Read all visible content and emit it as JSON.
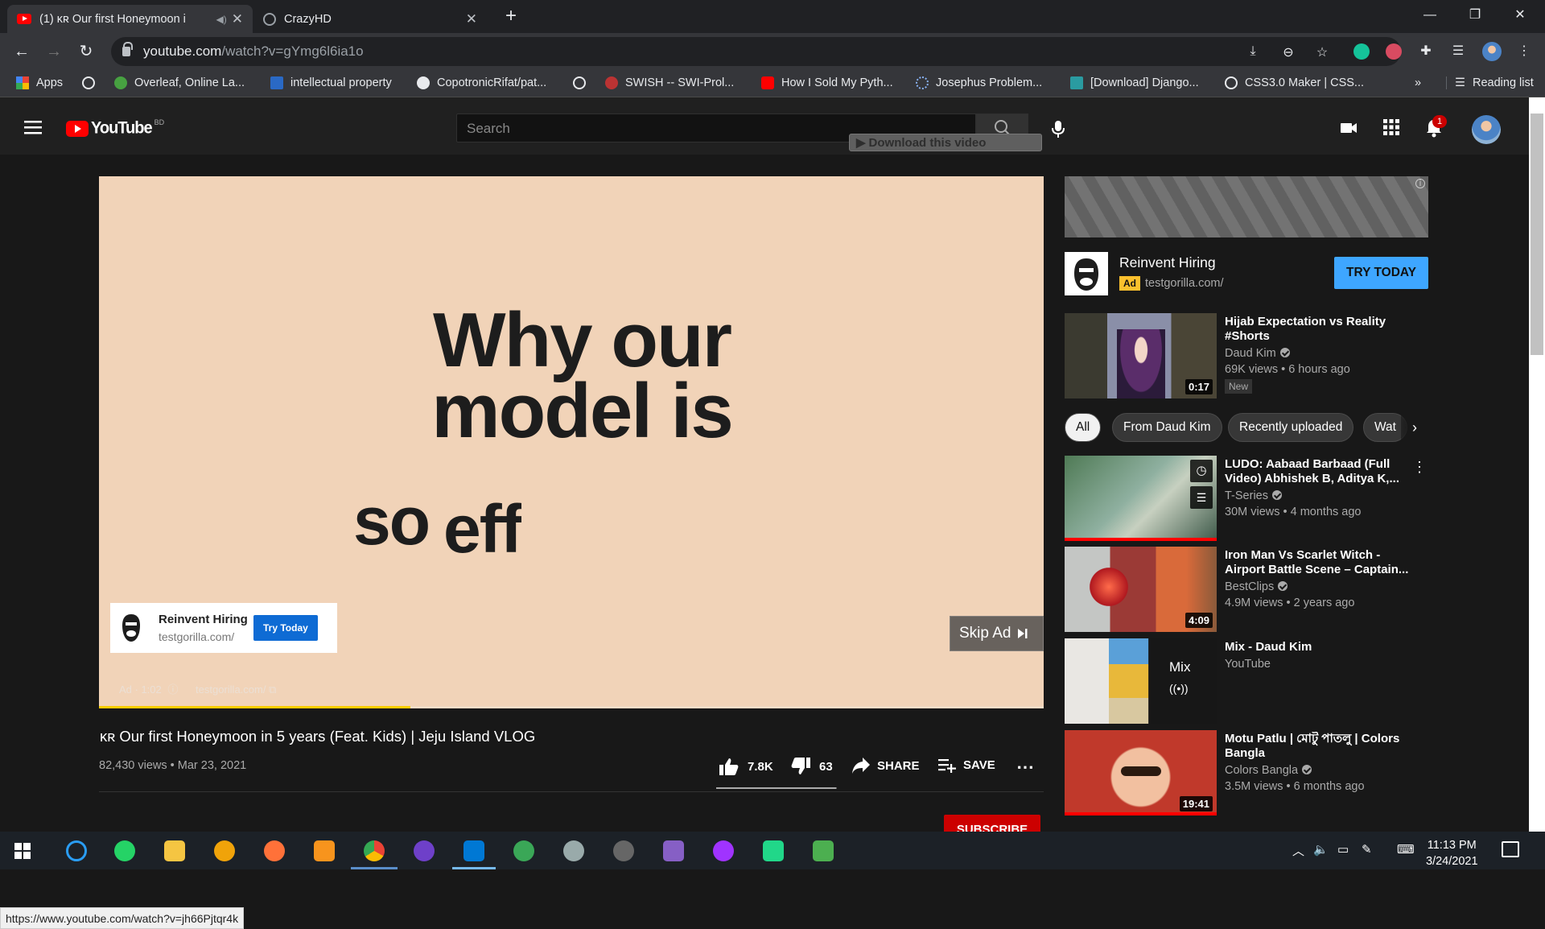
{
  "browser": {
    "tabs": [
      {
        "title": "(1) ĸʀ Our first Honeymoon i",
        "active": true
      },
      {
        "title": "CrazyHD",
        "active": false
      }
    ],
    "url_host": "youtube.com",
    "url_path": "/watch?v=gYmg6l6ia1o",
    "reading_list": "Reading list",
    "bookmarks": [
      "Apps",
      "Overleaf, Online La...",
      "intellectual property",
      "CopotronicRifat/pat...",
      "SWISH -- SWI-Prol...",
      "How I Sold My Pyth...",
      "Josephus Problem...",
      "[Download] Django...",
      "CSS3.0 Maker | CSS..."
    ],
    "overflow": "»"
  },
  "youtube": {
    "logo": "YouTube",
    "country": "BD",
    "search_placeholder": "Search",
    "download_label": "Download this video",
    "notif_count": "1",
    "video": {
      "slide_line1": "Why our",
      "slide_line2": "model is",
      "slide_line3_a": "so",
      "slide_line3_b": "eff",
      "ad_name": "Reinvent Hiring",
      "ad_domain": "testgorilla.com/",
      "ad_btn": "Try Today",
      "skip": "Skip Ad",
      "ad_time": "Ad · 1:02",
      "ad_link": "testgorilla.com/",
      "ad_progress": 0.33,
      "title": "ĸʀ Our first Honeymoon in 5 years (Feat. Kids) | Jeju Island VLOG",
      "meta": "82,430 views • Mar 23, 2021",
      "likes": "7.8K",
      "dislikes": "63",
      "like_ratio": 0.99,
      "share": "SHARE",
      "save": "SAVE",
      "subscribe": "SUBSCRIBE"
    },
    "side_ad": {
      "name": "Reinvent Hiring",
      "ad_badge": "Ad",
      "domain": "testgorilla.com/",
      "cta": "TRY TODAY"
    },
    "chips": [
      "All",
      "From Daud Kim",
      "Recently uploaded",
      "Wat"
    ],
    "recs": [
      {
        "title": "Hijab Expectation vs Reality #Shorts",
        "channel": "Daud Kim",
        "meta": "69K views • 6 hours ago",
        "badge": "New",
        "duration": "0:17"
      },
      {
        "title": "LUDO: Aabaad Barbaad (Full Video) Abhishek B, Aditya K,...",
        "channel": "T-Series",
        "meta": "30M views • 4 months ago",
        "duration": ""
      },
      {
        "title": "Iron Man Vs Scarlet Witch - Airport Battle Scene – Captain...",
        "channel": "BestClips",
        "meta": "4.9M views • 2 years ago",
        "duration": "4:09"
      },
      {
        "title": "Mix - Daud Kim",
        "channel": "YouTube",
        "meta": "",
        "duration": "",
        "mix": "Mix"
      },
      {
        "title": "Motu Patlu | মোটু পাতলু | Colors Bangla",
        "channel": "Colors Bangla",
        "meta": "3.5M views • 6 months ago",
        "duration": "19:41"
      }
    ],
    "status_url": "https://www.youtube.com/watch?v=jh66Pjtqr4k"
  },
  "taskbar": {
    "time": "11:13 PM",
    "date": "3/24/2021"
  }
}
